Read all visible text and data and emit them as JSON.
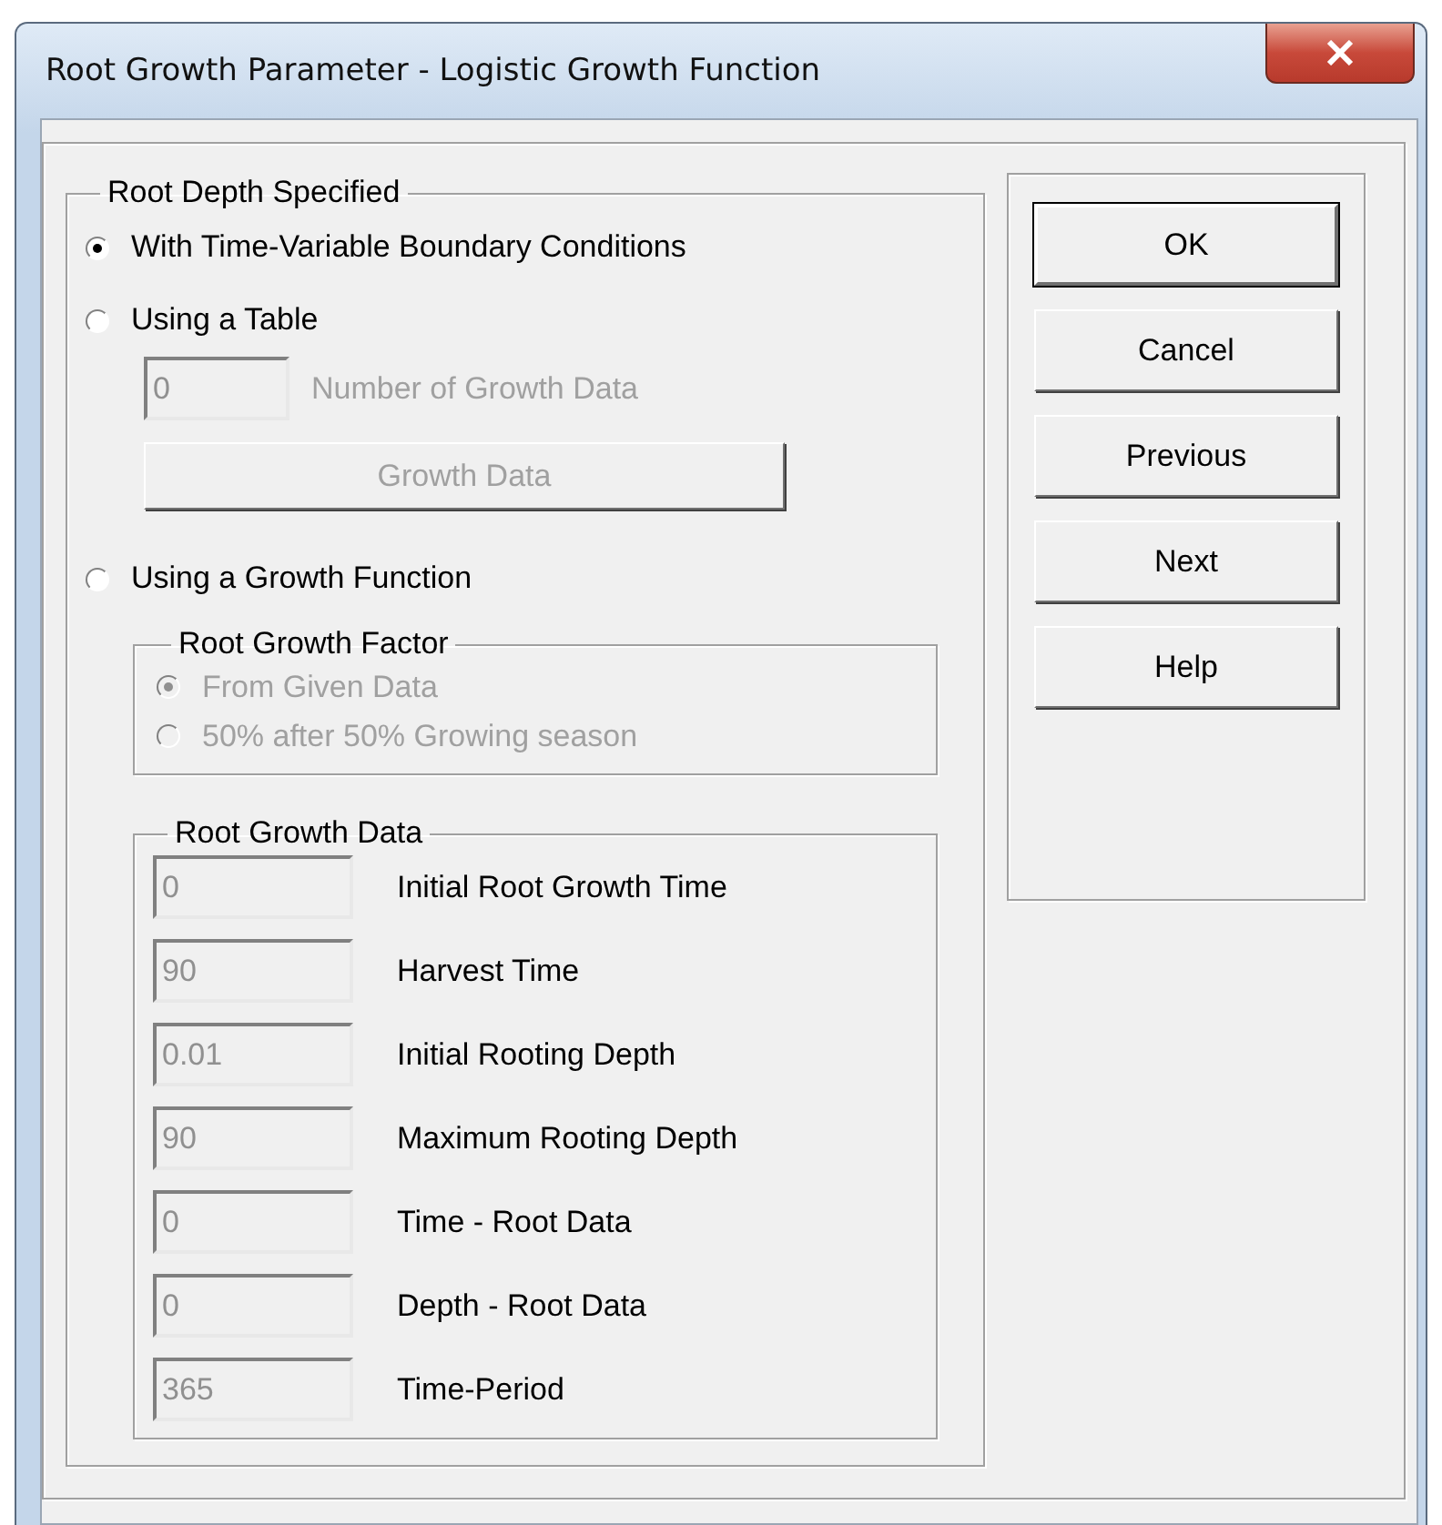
{
  "window": {
    "title": "Root Growth Parameter - Logistic Growth Function"
  },
  "root_depth": {
    "label": "Root Depth Specified",
    "options": [
      {
        "label": "With Time-Variable Boundary Conditions",
        "selected": true
      },
      {
        "label": "Using a Table",
        "selected": false
      },
      {
        "label": "Using a Growth Function",
        "selected": false
      }
    ],
    "table_count": {
      "value": "0",
      "label": "Number of Growth Data",
      "disabled": true
    },
    "growth_data_button": {
      "label": "Growth Data",
      "disabled": true
    },
    "factor": {
      "label": "Root Growth Factor",
      "options": [
        {
          "label": "From Given Data",
          "selected": true,
          "disabled": true
        },
        {
          "label": "50% after 50% Growing season",
          "selected": false,
          "disabled": true
        }
      ]
    },
    "data": {
      "label": "Root Growth Data",
      "fields": [
        {
          "value": "0",
          "label": "Initial Root Growth Time",
          "disabled": true
        },
        {
          "value": "90",
          "label": "Harvest Time",
          "disabled": true
        },
        {
          "value": "0.01",
          "label": "Initial Rooting Depth",
          "disabled": true
        },
        {
          "value": "90",
          "label": "Maximum Rooting Depth",
          "disabled": true
        },
        {
          "value": "0",
          "label": "Time - Root Data",
          "disabled": true
        },
        {
          "value": "0",
          "label": "Depth - Root Data",
          "disabled": true
        },
        {
          "value": "365",
          "label": "Time-Period",
          "disabled": true
        }
      ]
    }
  },
  "buttons": [
    {
      "label": "OK",
      "default": true
    },
    {
      "label": "Cancel",
      "default": false
    },
    {
      "label": "Previous",
      "default": false
    },
    {
      "label": "Next",
      "default": false
    },
    {
      "label": "Help",
      "default": false
    }
  ]
}
